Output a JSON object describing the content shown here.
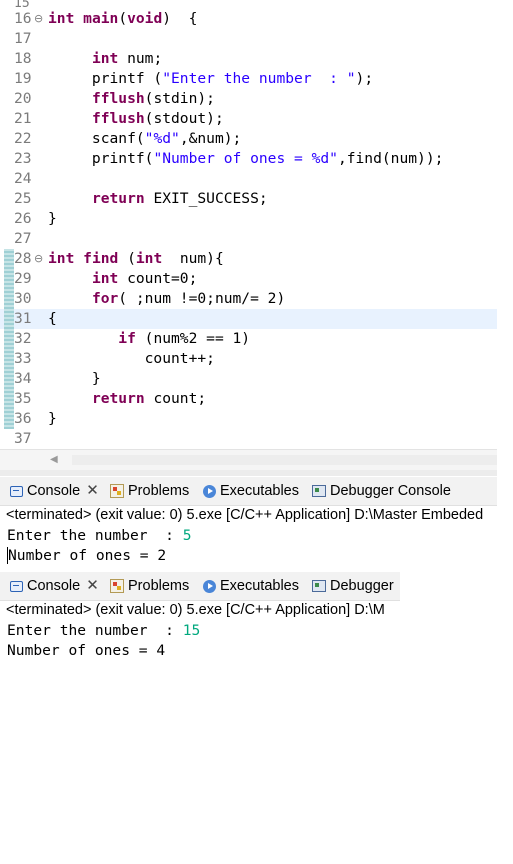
{
  "editor": {
    "top_partial": "15",
    "lines": [
      {
        "num": "16",
        "fold": "⊖",
        "tokens": [
          {
            "t": "int",
            "c": "kw"
          },
          {
            "t": " "
          },
          {
            "t": "main",
            "c": "kw"
          },
          {
            "t": "("
          },
          {
            "t": "void",
            "c": "kw"
          },
          {
            "t": ")  {"
          }
        ]
      },
      {
        "num": "17",
        "tokens": []
      },
      {
        "num": "18",
        "tokens": [
          {
            "t": "     "
          },
          {
            "t": "int",
            "c": "kw"
          },
          {
            "t": " num;"
          }
        ]
      },
      {
        "num": "19",
        "tokens": [
          {
            "t": "     printf ("
          },
          {
            "t": "\"Enter the number  : \"",
            "c": "str"
          },
          {
            "t": ");"
          }
        ]
      },
      {
        "num": "20",
        "tokens": [
          {
            "t": "     "
          },
          {
            "t": "fflush",
            "c": "kw"
          },
          {
            "t": "(stdin);"
          }
        ]
      },
      {
        "num": "21",
        "tokens": [
          {
            "t": "     "
          },
          {
            "t": "fflush",
            "c": "kw"
          },
          {
            "t": "(stdout);"
          }
        ]
      },
      {
        "num": "22",
        "tokens": [
          {
            "t": "     scanf("
          },
          {
            "t": "\"%d\"",
            "c": "str"
          },
          {
            "t": ",&num);"
          }
        ]
      },
      {
        "num": "23",
        "tokens": [
          {
            "t": "     printf("
          },
          {
            "t": "\"Number of ones = %d\"",
            "c": "str"
          },
          {
            "t": ",find(num));"
          }
        ]
      },
      {
        "num": "24",
        "tokens": []
      },
      {
        "num": "25",
        "tokens": [
          {
            "t": "     "
          },
          {
            "t": "return",
            "c": "kw"
          },
          {
            "t": " EXIT_SUCCESS;"
          }
        ]
      },
      {
        "num": "26",
        "tokens": [
          {
            "t": "}"
          }
        ]
      },
      {
        "num": "27",
        "tokens": []
      },
      {
        "num": "28",
        "fold": "⊖",
        "tokens": [
          {
            "t": "int",
            "c": "kw"
          },
          {
            "t": " "
          },
          {
            "t": "find",
            "c": "kw"
          },
          {
            "t": " ("
          },
          {
            "t": "int",
            "c": "kw"
          },
          {
            "t": "  num){"
          }
        ]
      },
      {
        "num": "29",
        "tokens": [
          {
            "t": "     "
          },
          {
            "t": "int",
            "c": "kw"
          },
          {
            "t": " count=0;"
          }
        ]
      },
      {
        "num": "30",
        "tokens": [
          {
            "t": "     "
          },
          {
            "t": "for",
            "c": "kw"
          },
          {
            "t": "( ;num !=0;num/= 2)"
          }
        ]
      },
      {
        "num": "31",
        "hl": true,
        "tokens": [
          {
            "t": "{"
          }
        ]
      },
      {
        "num": "32",
        "tokens": [
          {
            "t": "        "
          },
          {
            "t": "if",
            "c": "kw"
          },
          {
            "t": " (num%2 == 1)"
          }
        ]
      },
      {
        "num": "33",
        "tokens": [
          {
            "t": "           count++;"
          }
        ]
      },
      {
        "num": "34",
        "tokens": [
          {
            "t": "     }"
          }
        ]
      },
      {
        "num": "35",
        "tokens": [
          {
            "t": "     "
          },
          {
            "t": "return",
            "c": "kw"
          },
          {
            "t": " count;"
          }
        ]
      },
      {
        "num": "36",
        "tokens": [
          {
            "t": "}"
          }
        ]
      },
      {
        "num": "37",
        "tokens": []
      }
    ]
  },
  "console1": {
    "tabs": {
      "console": "Console",
      "problems": "Problems",
      "executables": "Executables",
      "debugger": "Debugger Console"
    },
    "status": "<terminated> (exit value: 0) 5.exe [C/C++ Application] D:\\Master Embeded",
    "line1_prompt": "Enter the number  : ",
    "line1_input": "5",
    "line2": "Number of ones = 2"
  },
  "console2": {
    "tabs": {
      "console": "Console",
      "problems": "Problems",
      "executables": "Executables",
      "debugger": "Debugger"
    },
    "status": "<terminated> (exit value: 0) 5.exe [C/C++ Application] D:\\M",
    "line1_prompt": "Enter the number  : ",
    "line1_input": "15",
    "line2": "Number of ones = 4"
  },
  "icons": {
    "console": "console-icon",
    "problems": "problems-icon",
    "executables": "executables-icon",
    "debugger": "debugger-console-icon",
    "close": "close-icon",
    "scroll_left": "scroll-left-arrow-icon"
  },
  "colors": {
    "keyword": "#7f0055",
    "string": "#2a00ff",
    "user_input": "#00a87e",
    "highlight_line": "#e8f2fe"
  }
}
